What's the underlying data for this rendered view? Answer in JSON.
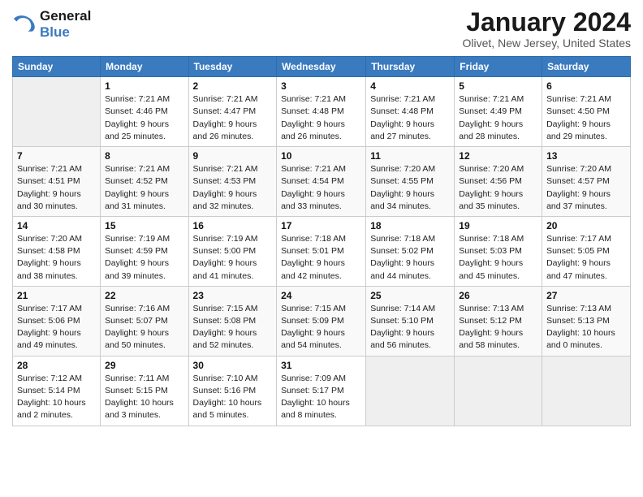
{
  "logo": {
    "line1": "General",
    "line2": "Blue"
  },
  "title": "January 2024",
  "subtitle": "Olivet, New Jersey, United States",
  "days_of_week": [
    "Sunday",
    "Monday",
    "Tuesday",
    "Wednesday",
    "Thursday",
    "Friday",
    "Saturday"
  ],
  "weeks": [
    [
      {
        "day": "",
        "sunrise": "",
        "sunset": "",
        "daylight": ""
      },
      {
        "day": "1",
        "sunrise": "Sunrise: 7:21 AM",
        "sunset": "Sunset: 4:46 PM",
        "daylight": "Daylight: 9 hours and 25 minutes."
      },
      {
        "day": "2",
        "sunrise": "Sunrise: 7:21 AM",
        "sunset": "Sunset: 4:47 PM",
        "daylight": "Daylight: 9 hours and 26 minutes."
      },
      {
        "day": "3",
        "sunrise": "Sunrise: 7:21 AM",
        "sunset": "Sunset: 4:48 PM",
        "daylight": "Daylight: 9 hours and 26 minutes."
      },
      {
        "day": "4",
        "sunrise": "Sunrise: 7:21 AM",
        "sunset": "Sunset: 4:48 PM",
        "daylight": "Daylight: 9 hours and 27 minutes."
      },
      {
        "day": "5",
        "sunrise": "Sunrise: 7:21 AM",
        "sunset": "Sunset: 4:49 PM",
        "daylight": "Daylight: 9 hours and 28 minutes."
      },
      {
        "day": "6",
        "sunrise": "Sunrise: 7:21 AM",
        "sunset": "Sunset: 4:50 PM",
        "daylight": "Daylight: 9 hours and 29 minutes."
      }
    ],
    [
      {
        "day": "7",
        "sunrise": "Sunrise: 7:21 AM",
        "sunset": "Sunset: 4:51 PM",
        "daylight": "Daylight: 9 hours and 30 minutes."
      },
      {
        "day": "8",
        "sunrise": "Sunrise: 7:21 AM",
        "sunset": "Sunset: 4:52 PM",
        "daylight": "Daylight: 9 hours and 31 minutes."
      },
      {
        "day": "9",
        "sunrise": "Sunrise: 7:21 AM",
        "sunset": "Sunset: 4:53 PM",
        "daylight": "Daylight: 9 hours and 32 minutes."
      },
      {
        "day": "10",
        "sunrise": "Sunrise: 7:21 AM",
        "sunset": "Sunset: 4:54 PM",
        "daylight": "Daylight: 9 hours and 33 minutes."
      },
      {
        "day": "11",
        "sunrise": "Sunrise: 7:20 AM",
        "sunset": "Sunset: 4:55 PM",
        "daylight": "Daylight: 9 hours and 34 minutes."
      },
      {
        "day": "12",
        "sunrise": "Sunrise: 7:20 AM",
        "sunset": "Sunset: 4:56 PM",
        "daylight": "Daylight: 9 hours and 35 minutes."
      },
      {
        "day": "13",
        "sunrise": "Sunrise: 7:20 AM",
        "sunset": "Sunset: 4:57 PM",
        "daylight": "Daylight: 9 hours and 37 minutes."
      }
    ],
    [
      {
        "day": "14",
        "sunrise": "Sunrise: 7:20 AM",
        "sunset": "Sunset: 4:58 PM",
        "daylight": "Daylight: 9 hours and 38 minutes."
      },
      {
        "day": "15",
        "sunrise": "Sunrise: 7:19 AM",
        "sunset": "Sunset: 4:59 PM",
        "daylight": "Daylight: 9 hours and 39 minutes."
      },
      {
        "day": "16",
        "sunrise": "Sunrise: 7:19 AM",
        "sunset": "Sunset: 5:00 PM",
        "daylight": "Daylight: 9 hours and 41 minutes."
      },
      {
        "day": "17",
        "sunrise": "Sunrise: 7:18 AM",
        "sunset": "Sunset: 5:01 PM",
        "daylight": "Daylight: 9 hours and 42 minutes."
      },
      {
        "day": "18",
        "sunrise": "Sunrise: 7:18 AM",
        "sunset": "Sunset: 5:02 PM",
        "daylight": "Daylight: 9 hours and 44 minutes."
      },
      {
        "day": "19",
        "sunrise": "Sunrise: 7:18 AM",
        "sunset": "Sunset: 5:03 PM",
        "daylight": "Daylight: 9 hours and 45 minutes."
      },
      {
        "day": "20",
        "sunrise": "Sunrise: 7:17 AM",
        "sunset": "Sunset: 5:05 PM",
        "daylight": "Daylight: 9 hours and 47 minutes."
      }
    ],
    [
      {
        "day": "21",
        "sunrise": "Sunrise: 7:17 AM",
        "sunset": "Sunset: 5:06 PM",
        "daylight": "Daylight: 9 hours and 49 minutes."
      },
      {
        "day": "22",
        "sunrise": "Sunrise: 7:16 AM",
        "sunset": "Sunset: 5:07 PM",
        "daylight": "Daylight: 9 hours and 50 minutes."
      },
      {
        "day": "23",
        "sunrise": "Sunrise: 7:15 AM",
        "sunset": "Sunset: 5:08 PM",
        "daylight": "Daylight: 9 hours and 52 minutes."
      },
      {
        "day": "24",
        "sunrise": "Sunrise: 7:15 AM",
        "sunset": "Sunset: 5:09 PM",
        "daylight": "Daylight: 9 hours and 54 minutes."
      },
      {
        "day": "25",
        "sunrise": "Sunrise: 7:14 AM",
        "sunset": "Sunset: 5:10 PM",
        "daylight": "Daylight: 9 hours and 56 minutes."
      },
      {
        "day": "26",
        "sunrise": "Sunrise: 7:13 AM",
        "sunset": "Sunset: 5:12 PM",
        "daylight": "Daylight: 9 hours and 58 minutes."
      },
      {
        "day": "27",
        "sunrise": "Sunrise: 7:13 AM",
        "sunset": "Sunset: 5:13 PM",
        "daylight": "Daylight: 10 hours and 0 minutes."
      }
    ],
    [
      {
        "day": "28",
        "sunrise": "Sunrise: 7:12 AM",
        "sunset": "Sunset: 5:14 PM",
        "daylight": "Daylight: 10 hours and 2 minutes."
      },
      {
        "day": "29",
        "sunrise": "Sunrise: 7:11 AM",
        "sunset": "Sunset: 5:15 PM",
        "daylight": "Daylight: 10 hours and 3 minutes."
      },
      {
        "day": "30",
        "sunrise": "Sunrise: 7:10 AM",
        "sunset": "Sunset: 5:16 PM",
        "daylight": "Daylight: 10 hours and 5 minutes."
      },
      {
        "day": "31",
        "sunrise": "Sunrise: 7:09 AM",
        "sunset": "Sunset: 5:17 PM",
        "daylight": "Daylight: 10 hours and 8 minutes."
      },
      {
        "day": "",
        "sunrise": "",
        "sunset": "",
        "daylight": ""
      },
      {
        "day": "",
        "sunrise": "",
        "sunset": "",
        "daylight": ""
      },
      {
        "day": "",
        "sunrise": "",
        "sunset": "",
        "daylight": ""
      }
    ]
  ]
}
